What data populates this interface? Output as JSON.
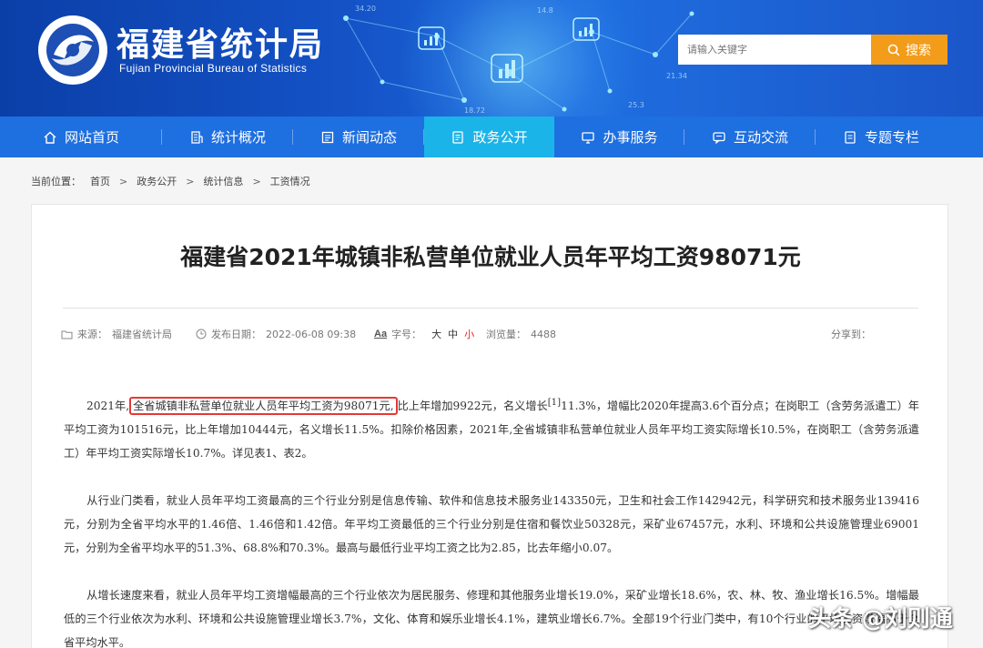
{
  "header": {
    "title": "福建省统计局",
    "subtitle": "Fujian Provincial Bureau of Statistics",
    "search_placeholder": "请输入关键字",
    "search_button": "搜索",
    "deco_numbers": [
      "34.20",
      "18.72",
      "25.3",
      "21.34",
      "14.8"
    ]
  },
  "nav": {
    "items": [
      {
        "label": "网站首页",
        "icon": "home-icon"
      },
      {
        "label": "统计概况",
        "icon": "building-icon"
      },
      {
        "label": "新闻动态",
        "icon": "news-icon"
      },
      {
        "label": "政务公开",
        "icon": "document-icon",
        "active": true
      },
      {
        "label": "办事服务",
        "icon": "monitor-icon"
      },
      {
        "label": "互动交流",
        "icon": "chat-icon"
      },
      {
        "label": "专题专栏",
        "icon": "list-icon"
      }
    ]
  },
  "breadcrumb": {
    "prefix": "当前位置：",
    "items": [
      "首页",
      "政务公开",
      "统计信息",
      "工资情况"
    ],
    "separator": ">"
  },
  "article": {
    "title": "福建省2021年城镇非私营单位就业人员年平均工资98071元",
    "meta": {
      "source_label": "来源：",
      "source": "福建省统计局",
      "date_label": "发布日期：",
      "date": "2022-06-08 09:38",
      "font_label": "字号：",
      "font_sizes": [
        "大",
        "中",
        "小"
      ],
      "views_label": "浏览量：",
      "views": "4488",
      "share_label": "分享到："
    },
    "p1_before": "2021年,",
    "p1_highlight": "全省城镇非私营单位就业人员年平均工资为98071元,",
    "p1_after_a": "比上年增加9922元，名义增长",
    "p1_footnote": "[1]",
    "p1_after_b": "11.3%，增幅比2020年提高3.6个百分点；在岗职工（含劳务派遣工）年平均工资为101516元，比上年增加10444元，名义增长11.5%。扣除价格因素，2021年,全省城镇非私营单位就业人员年平均工资实际增长10.5%，在岗职工（含劳务派遣工）年平均工资实际增长10.7%。详见表1、表2。",
    "p2": "从行业门类看，就业人员年平均工资最高的三个行业分别是信息传输、软件和信息技术服务业143350元，卫生和社会工作142942元，科学研究和技术服务业139416元，分别为全省平均水平的1.46倍、1.46倍和1.42倍。年平均工资最低的三个行业分别是住宿和餐饮业50328元，采矿业67457元，水利、环境和公共设施管理业69001元，分别为全省平均水平的51.3%、68.8%和70.3%。最高与最低行业平均工资之比为2.85，比去年缩小0.07。",
    "p3": "从增长速度来看，就业人员年平均工资增幅最高的三个行业依次为居民服务、修理和其他服务业增长19.0%，采矿业增长18.6%，农、林、牧、渔业增长16.5%。增幅最低的三个行业依次为水利、环境和公共设施管理业增长3.7%，文化、体育和娱乐业增长4.1%，建筑业增长6.7%。全部19个行业门类中，有10个行业的平均工资增幅高于全省平均水平。"
  },
  "watermark": "头条 @刘则通",
  "colors": {
    "nav_bg": "#1e6fe0",
    "nav_active": "#1bb4e8",
    "search_button": "#f39c1a",
    "highlight_border": "#e53935"
  }
}
